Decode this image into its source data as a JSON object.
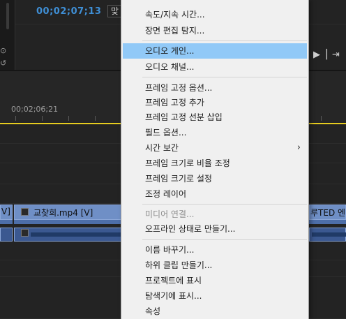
{
  "monitor": {
    "timecode": "00;02;07;13",
    "fit_dropdown_text": "맞"
  },
  "timeline": {
    "ruler_time": "00;02;06;21",
    "clips": {
      "left_fragment": "V]",
      "main_clip": "교찾희.mp4 [V]",
      "right_fragment": "루TED 엔"
    }
  },
  "context_menu": {
    "groups": [
      {
        "items": [
          {
            "label": "속도/지속 시간...",
            "enabled": true
          },
          {
            "label": "장면 편집 탐지...",
            "enabled": true
          }
        ]
      },
      {
        "items": [
          {
            "label": "오디오 게인...",
            "enabled": true,
            "highlighted": true
          },
          {
            "label": "오디오 채널...",
            "enabled": true
          }
        ]
      },
      {
        "items": [
          {
            "label": "프레임 고정 옵션...",
            "enabled": true
          },
          {
            "label": "프레임 고정 추가",
            "enabled": true
          },
          {
            "label": "프레임 고정 선분 삽입",
            "enabled": true
          },
          {
            "label": "필드 옵션...",
            "enabled": true
          },
          {
            "label": "시간 보간",
            "enabled": true,
            "submenu": true
          },
          {
            "label": "프레임 크기로 비율 조정",
            "enabled": true
          },
          {
            "label": "프레임 크기로 설정",
            "enabled": true
          },
          {
            "label": "조정 레이어",
            "enabled": true
          }
        ]
      },
      {
        "items": [
          {
            "label": "미디어 연결...",
            "enabled": false
          },
          {
            "label": "오프라인 상태로 만들기...",
            "enabled": true
          }
        ]
      },
      {
        "items": [
          {
            "label": "이름 바꾸기...",
            "enabled": true
          },
          {
            "label": "하위 클립 만들기...",
            "enabled": true
          },
          {
            "label": "프로젝트에 표시",
            "enabled": true
          },
          {
            "label": "탐색기에 표시...",
            "enabled": true
          },
          {
            "label": "속성",
            "enabled": true
          }
        ]
      }
    ]
  },
  "colors": {
    "timecode": "#3f8fd6",
    "work_area_bar": "#e6cc1f",
    "menu_highlight": "#91c9f7",
    "clip_video": "#6f8fc6",
    "clip_audio": "#3b5890"
  },
  "icons": {
    "submenu": "chevron-right-icon",
    "clip_fx": "fx-badge-icon",
    "transport_step_forward": "step-forward-icon",
    "transport_export_frame": "export-frame-icon"
  }
}
